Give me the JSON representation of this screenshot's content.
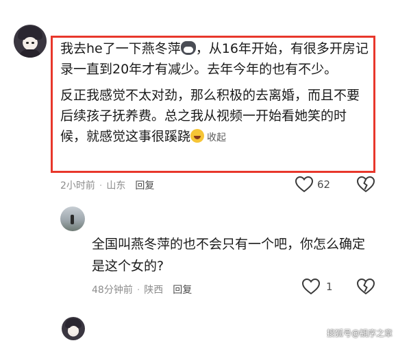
{
  "comment": {
    "para1_a": "我去he了一下燕冬萍",
    "para1_b": "，从16年开始，有很多开房记录一直到20年才有减少。去年今年的也有不少。",
    "para2_a": "反正我感觉不太对劲，那么积极的去离婚，而且不要后续孩子抚养费。总之我从视频一开始看她笑的时候，就感觉这事很蹊跷",
    "collapse_label": "收起",
    "time": "2小时前",
    "location": "山东",
    "reply_label": "回复",
    "likes": "62"
  },
  "reply": {
    "text": "全国叫燕冬萍的也不会只有一个吧，你怎么确定是这个女的?",
    "time": "48分钟前",
    "location": "陕西",
    "reply_label": "回复",
    "likes": "1"
  },
  "watermark": "搜狐号@観序之章",
  "icons": {
    "like": "heart-outline-icon",
    "dislike": "broken-heart-icon",
    "cat_emoji": "cat-emoji-icon",
    "laugh_emoji": "laughing-emoji-icon"
  },
  "colors": {
    "highlight_border": "#e8372b"
  }
}
